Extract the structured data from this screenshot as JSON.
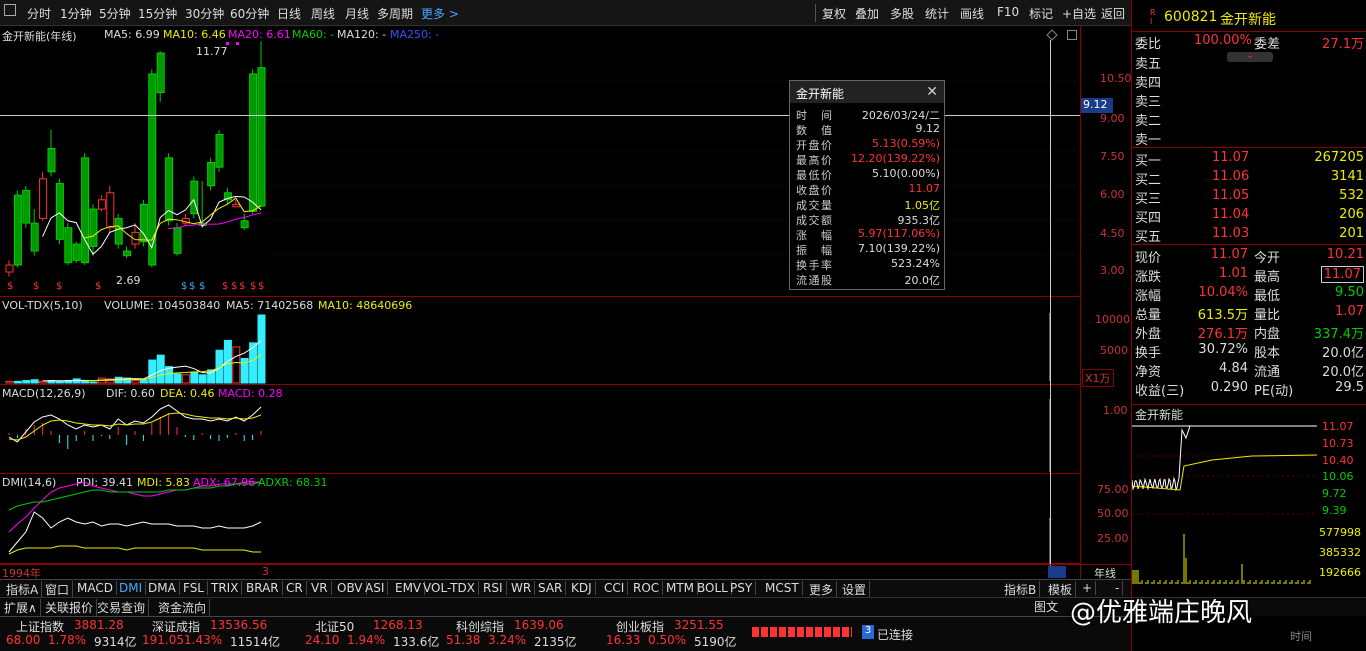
{
  "toolbar": {
    "periods": [
      "分时",
      "1分钟",
      "5分钟",
      "15分钟",
      "30分钟",
      "60分钟",
      "日线",
      "周线",
      "月线",
      "多周期",
      "更多 >"
    ],
    "right": [
      "复权",
      "叠加",
      "多股",
      "统计",
      "画线",
      "F10",
      "标记",
      "+自选",
      "返回"
    ]
  },
  "main": {
    "title": "金开新能(年线)",
    "ma5": "MA5: 6.99",
    "ma10": "MA10: 6.46",
    "ma20": "MA20: 6.61",
    "ma60": "MA60: -",
    "ma120": "MA120: -",
    "ma250": "MA250: -",
    "high_mark": "11.77",
    "low_mark": "2.69",
    "axis": [
      "10.50",
      "9.00",
      "7.50",
      "6.00",
      "4.50",
      "3.00"
    ],
    "crosshair_value": "9.12",
    "year_start": "1994年",
    "year_end": "3",
    "period": "年线"
  },
  "candles": [
    [
      2.3,
      2.6,
      2.1,
      2.8
    ],
    [
      5.6,
      2.6,
      2.5,
      5.8
    ],
    [
      5.8,
      4.4,
      4.2,
      6.0
    ],
    [
      4.4,
      3.2,
      3.0,
      5.0
    ],
    [
      4.6,
      6.3,
      4.5,
      6.6
    ],
    [
      7.6,
      6.6,
      6.4,
      8.4
    ],
    [
      6.1,
      3.7,
      3.5,
      6.3
    ],
    [
      4.2,
      2.7,
      2.6,
      4.4
    ],
    [
      3.5,
      2.8,
      2.69,
      3.6
    ],
    [
      7.2,
      2.7,
      2.6,
      7.4
    ],
    [
      5.0,
      3.4,
      3.0,
      5.2
    ],
    [
      5.0,
      5.4,
      4.9,
      5.6
    ],
    [
      4.2,
      5.7,
      4.0,
      6.0
    ],
    [
      4.6,
      3.5,
      3.3,
      4.8
    ],
    [
      3.2,
      3.0,
      2.9,
      3.4
    ],
    [
      3.5,
      4.0,
      3.3,
      4.4
    ],
    [
      5.2,
      3.6,
      3.4,
      5.4
    ],
    [
      10.8,
      2.6,
      2.5,
      11.0
    ],
    [
      11.7,
      10.0,
      9.6,
      11.77
    ],
    [
      7.2,
      4.5,
      4.3,
      7.4
    ],
    [
      4.2,
      3.1,
      3.0,
      4.4
    ],
    [
      4.4,
      4.6,
      4.3,
      4.8
    ],
    [
      6.2,
      4.8,
      4.6,
      6.4
    ],
    [
      4.4,
      4.3,
      4.2,
      6.2
    ],
    [
      7.0,
      6.0,
      5.8,
      7.2
    ],
    [
      8.2,
      6.8,
      6.6,
      8.4
    ],
    [
      5.7,
      5.4,
      5.2,
      5.9
    ],
    [
      5.1,
      5.2,
      5.1,
      5.4
    ],
    [
      4.5,
      4.2,
      4.1,
      4.8
    ],
    [
      10.8,
      4.9,
      4.8,
      11.0
    ],
    [
      11.07,
      5.13,
      5.1,
      12.2
    ]
  ],
  "volume": {
    "label": "VOL-TDX(5,10)",
    "value": "VOLUME: 104503840",
    "ma5": "MA5: 71402568",
    "ma10": "MA10: 48640696",
    "axis": [
      "10000",
      "5000"
    ],
    "unit": "X1万",
    "bars": [
      2,
      2,
      3,
      4,
      2,
      3,
      2,
      3,
      5,
      3,
      1,
      6,
      5,
      7,
      6,
      3,
      4,
      28,
      34,
      20,
      11,
      10,
      13,
      10,
      16,
      40,
      52,
      44,
      30,
      49,
      83
    ]
  },
  "macd": {
    "label": "MACD(12,26,9)",
    "dif": "DIF: 0.60",
    "dea": "DEA: 0.46",
    "macd": "MACD: 0.28",
    "axis": [
      "1.00"
    ]
  },
  "dmi": {
    "label": "DMI(14,6)",
    "pdi": "PDI: 39.41",
    "mdi": "MDI: 5.83",
    "adx": "ADX: 67.96",
    "adxr": "ADXR: 68.31",
    "axis": [
      "75.00",
      "50.00",
      "25.00"
    ]
  },
  "popup": {
    "title": "金开新能",
    "rows": [
      [
        "时间",
        "2026/03/24/二",
        "#ddd"
      ],
      [
        "数值",
        "9.12",
        "#ddd"
      ],
      [
        "开盘价",
        "5.13(0.59%)",
        "#f33"
      ],
      [
        "最高价",
        "12.20(139.22%)",
        "#f33"
      ],
      [
        "最低价",
        "5.10(0.00%)",
        "#ddd"
      ],
      [
        "收盘价",
        "11.07",
        "#f33"
      ],
      [
        "成交量",
        "1.05亿",
        "#ee0"
      ],
      [
        "成交额",
        "935.3亿",
        "#ddd"
      ],
      [
        "涨幅",
        "5.97(117.06%)",
        "#f33"
      ],
      [
        "振幅",
        "7.10(139.22%)",
        "#ddd"
      ],
      [
        "换手率",
        "523.24%",
        "#ddd"
      ],
      [
        "流通股",
        "20.0亿",
        "#ddd"
      ]
    ]
  },
  "quote": {
    "code": "600821",
    "name": "金开新能",
    "wei_bi": "委比",
    "wei_bi_v": "100.00%",
    "wei_cha": "委差",
    "wei_cha_v": "27.1万",
    "sells": [
      "卖五",
      "卖四",
      "卖三",
      "卖二",
      "卖一"
    ],
    "buys": [
      [
        "买一",
        "11.07",
        "267205"
      ],
      [
        "买二",
        "11.06",
        "3141"
      ],
      [
        "买三",
        "11.05",
        "532"
      ],
      [
        "买四",
        "11.04",
        "206"
      ],
      [
        "买五",
        "11.03",
        "201"
      ]
    ],
    "stats": [
      [
        "现价",
        "11.07",
        "今开",
        "10.21"
      ],
      [
        "涨跌",
        "1.01",
        "最高",
        "11.07"
      ],
      [
        "涨幅",
        "10.04%",
        "最低",
        "9.50"
      ],
      [
        "总量",
        "613.5万",
        "量比",
        "1.07"
      ],
      [
        "外盘",
        "276.1万",
        "内盘",
        "337.4万"
      ],
      [
        "换手",
        "30.72%",
        "股本",
        "20.0亿"
      ],
      [
        "净资",
        "4.84",
        "流通",
        "20.0亿"
      ],
      [
        "收益(三)",
        "0.290",
        "PE(动)",
        "29.5"
      ]
    ],
    "mini_title": "金开新能",
    "mini_axis": [
      "11.07",
      "10.73",
      "10.40",
      "10.06",
      "9.72",
      "9.39"
    ],
    "mini_vol_axis": [
      "577998",
      "385332",
      "192666"
    ]
  },
  "tabs": [
    "指标A",
    "窗口",
    "MACD",
    "DMI",
    "DMA",
    "FSL",
    "TRIX",
    "BRAR",
    "CR",
    "VR",
    "OBV",
    "ASI",
    "EMV",
    "VOL-TDX",
    "RSI",
    "WR",
    "SAR",
    "KDJ",
    "CCI",
    "ROC",
    "MTM",
    "BOLL",
    "PSY",
    "MCST",
    "更多",
    "设置"
  ],
  "tabs_right": [
    "指标B",
    "模板",
    "+",
    "-"
  ],
  "tabs2": [
    "扩展∧",
    "关联报价",
    "交易查询",
    "资金流向"
  ],
  "status": [
    [
      "上证指数",
      "3881.28",
      "68.00",
      "1.78%",
      "9314亿"
    ],
    [
      "深证成指",
      "13536.56",
      "191.05",
      "1.43%",
      "11514亿"
    ],
    [
      "北证50",
      "1268.13",
      "24.10",
      "1.94%",
      "133.6亿"
    ],
    [
      "科创综指",
      "1639.06",
      "51.38",
      "3.24%",
      "2135亿"
    ],
    [
      "创业板指",
      "3251.55",
      "16.33",
      "0.50%",
      "5190亿"
    ]
  ],
  "connection": "已连接",
  "watermark": "@优雅端庄晚风",
  "bottom_right": [
    "图文",
    "时间"
  ]
}
